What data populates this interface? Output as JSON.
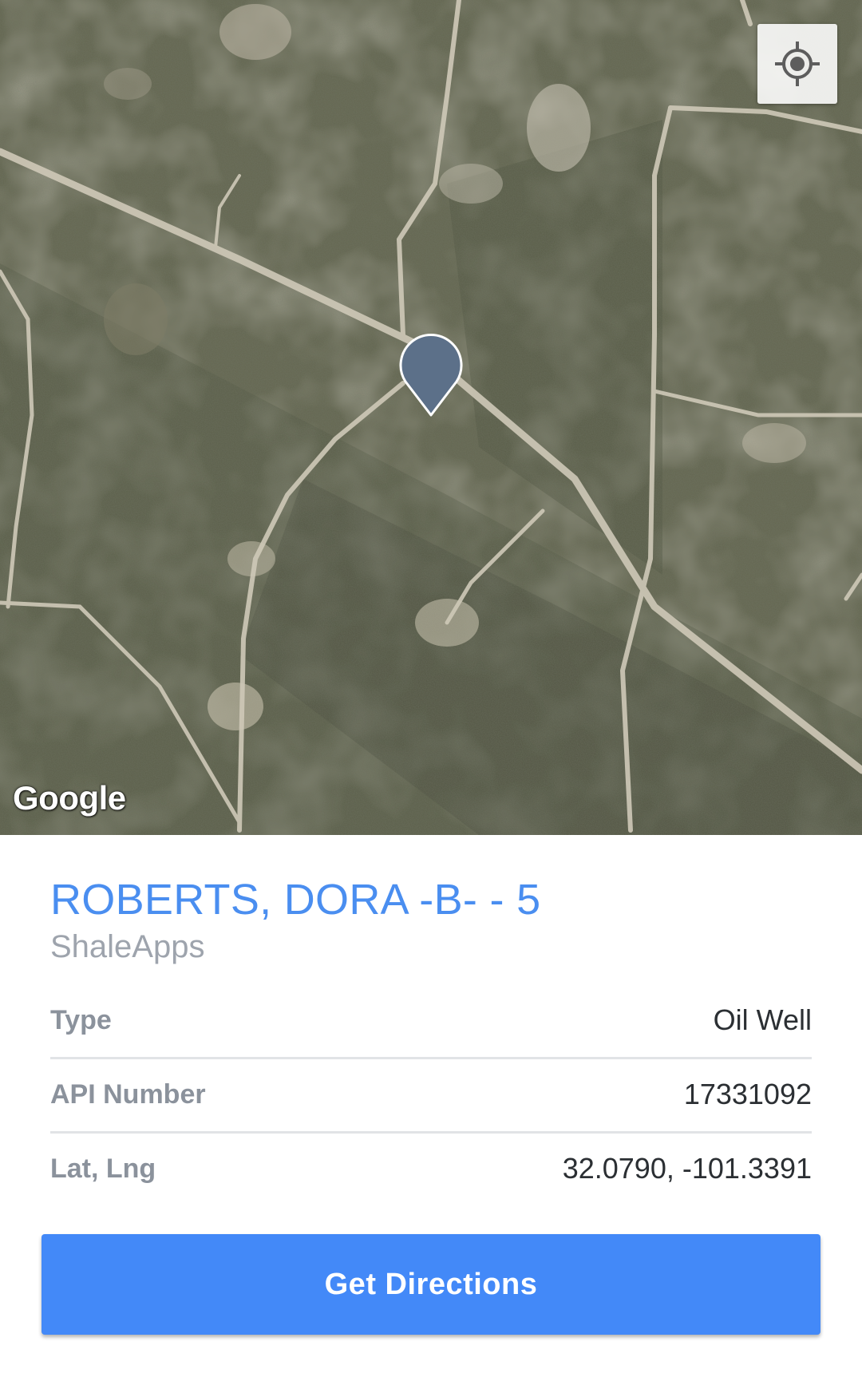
{
  "map": {
    "provider_logo": "Google",
    "my_location_icon": "crosshair-icon",
    "marker_icon": "map-pin-icon",
    "marker_color": "#5c7089"
  },
  "well": {
    "name": "ROBERTS, DORA -B- - 5",
    "operator": "ShaleApps",
    "fields": [
      {
        "label": "Type",
        "value": "Oil Well"
      },
      {
        "label": "API Number",
        "value": "17331092"
      },
      {
        "label": "Lat, Lng",
        "value": "32.0790, -101.3391"
      }
    ]
  },
  "actions": {
    "directions_label": "Get Directions"
  },
  "colors": {
    "title": "#4a8ef0",
    "button": "#4389f8",
    "label": "#8b929c"
  }
}
